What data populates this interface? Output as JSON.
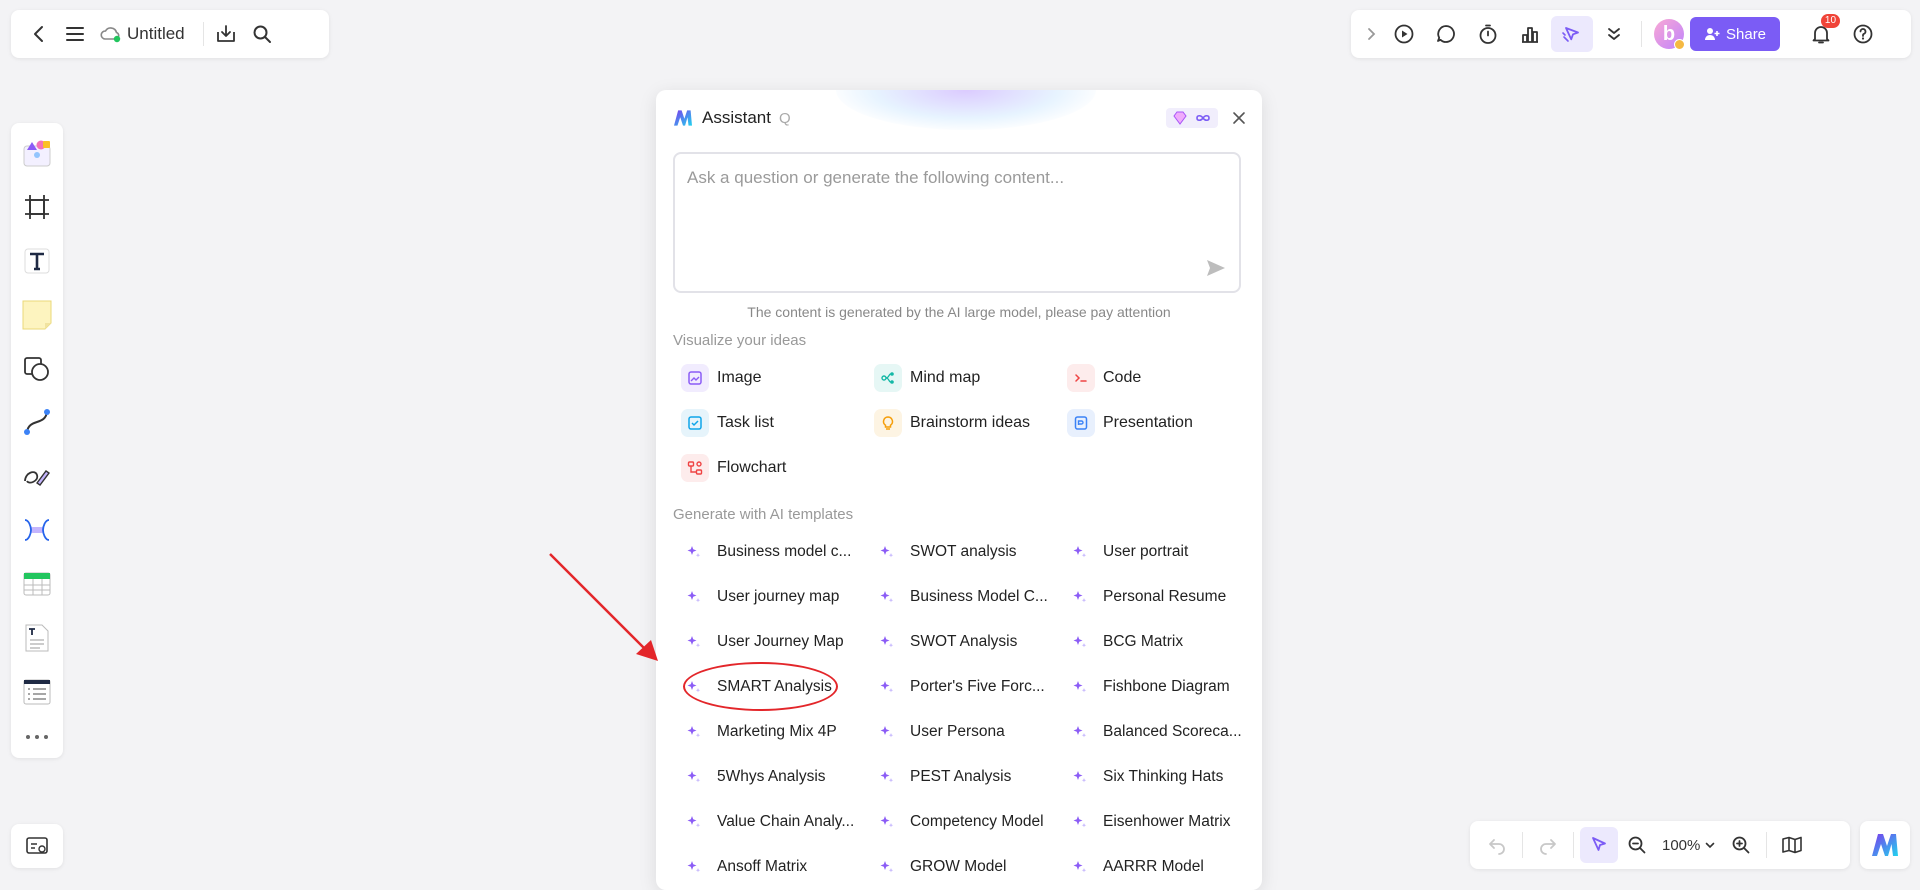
{
  "topbar": {
    "doc_title": "Untitled"
  },
  "header_right": {
    "share_label": "Share",
    "notification_count": "10",
    "avatar_letter": "b"
  },
  "assistant": {
    "title": "Assistant",
    "title_suffix": "Q",
    "input_placeholder": "Ask a question or generate the following content...",
    "disclaimer": "The content is generated by the AI large model, please pay attention",
    "visualize_title": "Visualize your ideas",
    "visualize_items": [
      {
        "label": "Image",
        "icon": "image-icon",
        "color": "#8b5cf6",
        "bg": "#f1ecfe"
      },
      {
        "label": "Mind map",
        "icon": "mind-map-icon",
        "color": "#14b8a6",
        "bg": "#e6f7f5"
      },
      {
        "label": "Code",
        "icon": "code-icon",
        "color": "#ef4444",
        "bg": "#fdecec"
      },
      {
        "label": "Task list",
        "icon": "task-list-icon",
        "color": "#0ea5e9",
        "bg": "#e6f4fb"
      },
      {
        "label": "Brainstorm ideas",
        "icon": "bulb-icon",
        "color": "#f59e0b",
        "bg": "#fdf4e3"
      },
      {
        "label": "Presentation",
        "icon": "presentation-icon",
        "color": "#3b82f6",
        "bg": "#e8f0fd"
      },
      {
        "label": "Flowchart",
        "icon": "flowchart-icon",
        "color": "#ef4444",
        "bg": "#fdecec"
      }
    ],
    "templates_title": "Generate with AI templates",
    "templates": [
      "Business model c...",
      "SWOT analysis",
      "User portrait",
      "User journey map",
      "Business Model C...",
      "Personal Resume",
      "User Journey Map",
      "SWOT Analysis",
      "BCG Matrix",
      "SMART Analysis",
      "Porter's Five Forc...",
      "Fishbone Diagram",
      "Marketing Mix 4P",
      "User Persona",
      "Balanced Scoreca...",
      "5Whys Analysis",
      "PEST Analysis",
      "Six Thinking Hats",
      "Value Chain Analy...",
      "Competency Model",
      "Eisenhower Matrix",
      "Ansoff Matrix",
      "GROW Model",
      "AARRR Model"
    ]
  },
  "zoom": {
    "level": "100%"
  },
  "colors": {
    "accent": "#7b5cf5",
    "annotation": "#e3262a"
  }
}
